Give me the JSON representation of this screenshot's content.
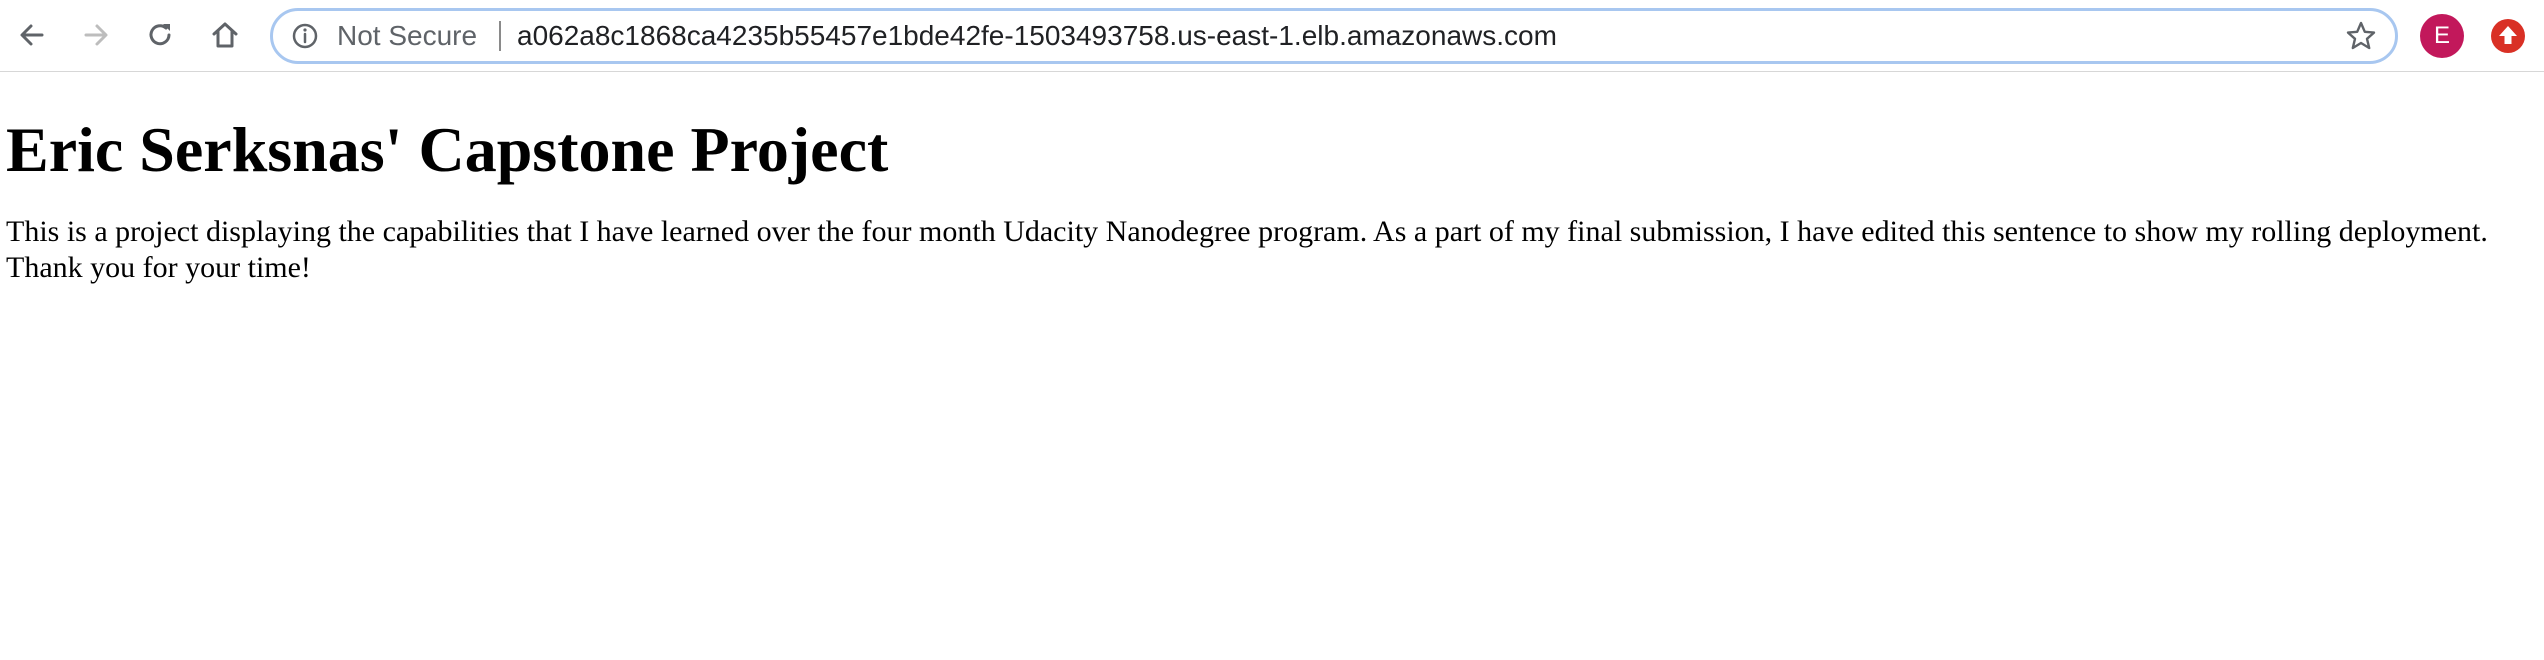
{
  "browser": {
    "nav": {
      "back_icon": "arrow-left-icon",
      "forward_icon": "arrow-right-icon",
      "reload_icon": "reload-icon",
      "home_icon": "home-icon"
    },
    "omnibox": {
      "security_icon": "info-circle-icon",
      "security_label": "Not Secure",
      "url": "a062a8c1868ca4235b55457e1bde42fe-1503493758.us-east-1.elb.amazonaws.com",
      "bookmark_icon": "star-outline-icon"
    },
    "profile": {
      "initial": "E",
      "color": "#c2185b"
    },
    "extension": {
      "icon": "update-arrow-icon",
      "color": "#d93025"
    }
  },
  "page": {
    "heading": "Eric Serksnas' Capstone Project",
    "paragraph": "This is a project displaying the capabilities that I have learned over the four month Udacity Nanodegree program. As a part of my final submission, I have edited this sentence to show my rolling deployment. Thank you for your time!"
  }
}
